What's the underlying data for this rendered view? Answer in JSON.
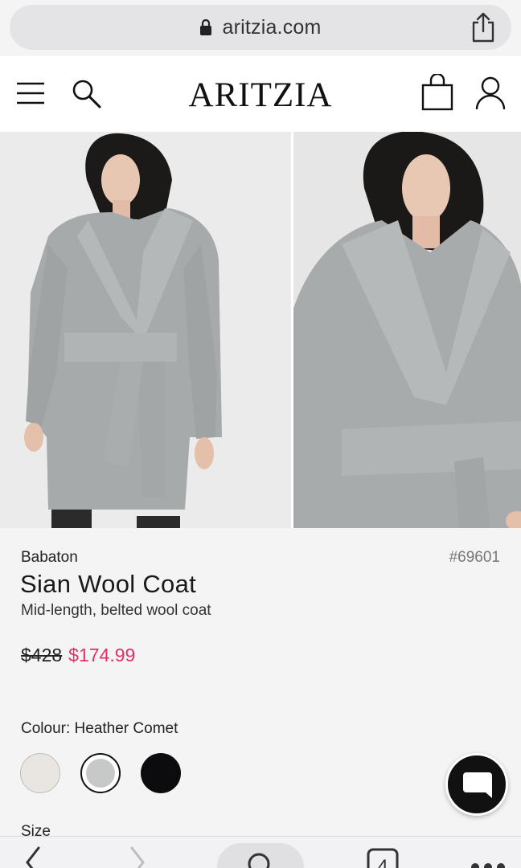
{
  "browser": {
    "url": "aritzia.com",
    "icons": {
      "lock": "lock-icon",
      "share": "share-icon"
    }
  },
  "header": {
    "logo": "ARITZIA",
    "icons": {
      "menu": "hamburger-icon",
      "search": "search-icon",
      "bag": "bag-icon",
      "account": "account-icon"
    }
  },
  "gallery": {
    "images": [
      {
        "name": "product-image-front"
      },
      {
        "name": "product-image-closeup"
      }
    ]
  },
  "product": {
    "brand": "Babaton",
    "sku": "#69601",
    "title": "Sian Wool Coat",
    "subtitle": "Mid-length, belted wool coat",
    "price_original": "$428",
    "price_sale": "$174.99",
    "sale_color": "#e0306a"
  },
  "colour": {
    "label": "Colour: Heather Comet",
    "swatches": [
      {
        "color": "#e9e5e0",
        "selected": false
      },
      {
        "color": "#c7c9c9",
        "selected": true
      },
      {
        "color": "#0c0c0f",
        "selected": false
      }
    ]
  },
  "size": {
    "label": "Size"
  },
  "chat": {
    "icon": "chat-bubble-icon"
  },
  "toolbar": {
    "tab_count": "4",
    "icons": [
      "back-icon",
      "forward-icon",
      "search-icon",
      "tabs-icon",
      "more-icon"
    ]
  }
}
